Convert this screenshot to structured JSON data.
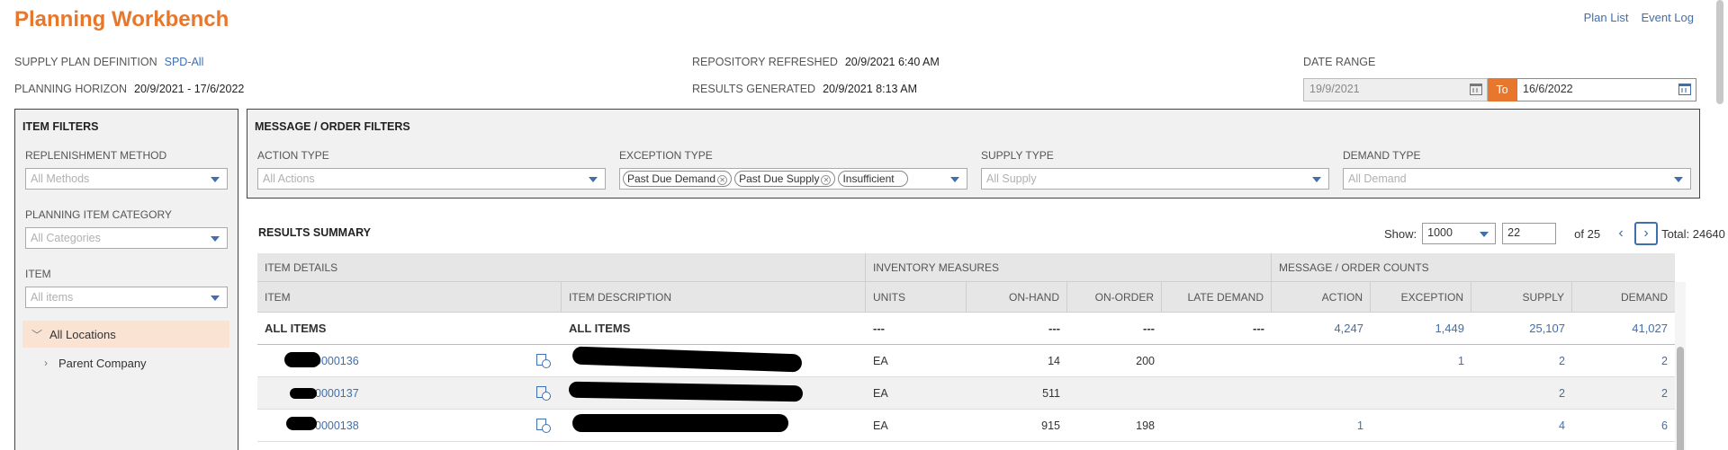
{
  "app": {
    "title": "Planning Workbench",
    "links": [
      "Plan List",
      "Event Log"
    ]
  },
  "meta": {
    "spd_label": "SUPPLY PLAN DEFINITION",
    "spd_value": "SPD-All",
    "horizon_label": "PLANNING HORIZON",
    "horizon_value": "20/9/2021 - 17/6/2022",
    "repo_label": "REPOSITORY REFRESHED",
    "repo_value": "20/9/2021 6:40 AM",
    "results_label": "RESULTS GENERATED",
    "results_value": "20/9/2021 8:13 AM",
    "date_range_label": "DATE RANGE",
    "date_from": "19/9/2021",
    "to_label": "To",
    "date_to": "16/6/2022"
  },
  "item_filters": {
    "title": "ITEM FILTERS",
    "replenishment_label": "REPLENISHMENT METHOD",
    "replenishment_placeholder": "All Methods",
    "category_label": "PLANNING ITEM CATEGORY",
    "category_placeholder": "All Categories",
    "item_label": "ITEM",
    "item_placeholder": "All items",
    "tree": [
      {
        "label": "All Locations",
        "expanded": true,
        "selected": true
      },
      {
        "label": "Parent Company",
        "expanded": false,
        "selected": false
      }
    ]
  },
  "message_filters": {
    "title": "MESSAGE / ORDER FILTERS",
    "action_label": "ACTION TYPE",
    "action_placeholder": "All Actions",
    "exception_label": "EXCEPTION TYPE",
    "exception_chips": [
      "Past Due Demand",
      "Past Due Supply",
      "Insufficient"
    ],
    "supply_label": "SUPPLY TYPE",
    "supply_placeholder": "All Supply",
    "demand_label": "DEMAND TYPE",
    "demand_placeholder": "All Demand"
  },
  "results": {
    "title": "RESULTS SUMMARY",
    "show_label": "Show:",
    "show_value": "1000",
    "page_value": "22",
    "of_label": "of 25",
    "total_label": "Total: 24640",
    "group_headers": {
      "item_details": "ITEM DETAILS",
      "inventory": "INVENTORY MEASURES",
      "counts": "MESSAGE / ORDER COUNTS"
    },
    "columns": {
      "item": "ITEM",
      "desc": "ITEM DESCRIPTION",
      "units": "UNITS",
      "on_hand": "ON-HAND",
      "on_order": "ON-ORDER",
      "late_demand": "LATE DEMAND",
      "action": "ACTION",
      "exception": "EXCEPTION",
      "supply": "SUPPLY",
      "demand": "DEMAND"
    },
    "all_row": {
      "item": "ALL ITEMS",
      "desc": "ALL ITEMS",
      "units": "---",
      "on_hand": "---",
      "on_order": "---",
      "late_demand": "---",
      "action": "4,247",
      "exception": "1,449",
      "supply": "25,107",
      "demand": "41,027"
    },
    "rows": [
      {
        "item": "0000136",
        "units": "EA",
        "on_hand": "14",
        "on_order": "200",
        "late_demand": "",
        "action": "",
        "exception": "1",
        "supply": "2",
        "demand": "2"
      },
      {
        "item": "0000137",
        "units": "EA",
        "on_hand": "511",
        "on_order": "",
        "late_demand": "",
        "action": "",
        "exception": "",
        "supply": "2",
        "demand": "2"
      },
      {
        "item": "0000138",
        "units": "EA",
        "on_hand": "915",
        "on_order": "198",
        "late_demand": "",
        "action": "1",
        "exception": "",
        "supply": "4",
        "demand": "6"
      }
    ]
  }
}
